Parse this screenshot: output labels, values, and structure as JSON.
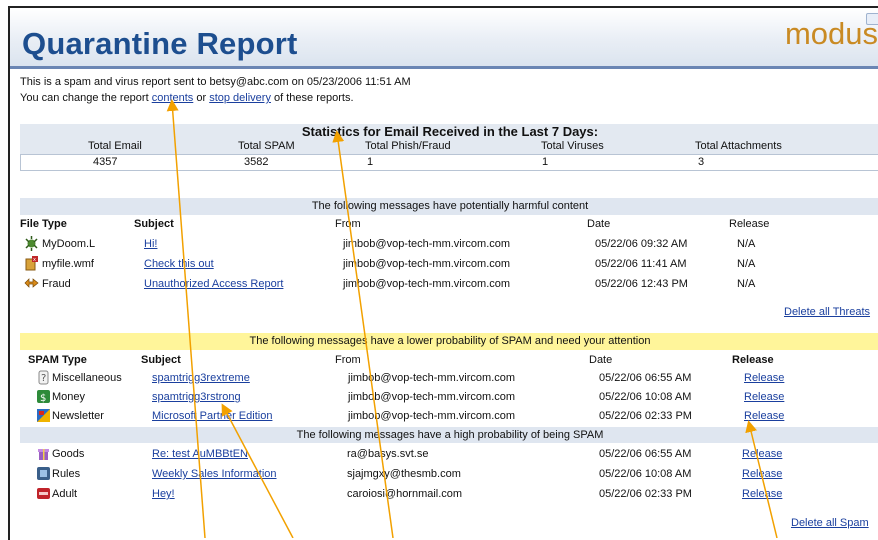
{
  "header": {
    "title": "Quarantine Report",
    "logo": "modus"
  },
  "intro": {
    "line1": "This is a spam and virus report sent to betsy@abc.com on 05/23/2006 11:51 AM",
    "line2_pre": "You can change the report ",
    "contents_link": "contents",
    "line2_mid": " or ",
    "stop_link": "stop delivery",
    "line2_post": " of these reports."
  },
  "stats": {
    "title": "Statistics for Email Received in the Last 7 Days:",
    "headers": [
      "Total Email",
      "Total SPAM",
      "Total Phish/Fraud",
      "Total Viruses",
      "Total Attachments"
    ],
    "values": [
      "4357",
      "3582",
      "1",
      "1",
      "3"
    ]
  },
  "threats": {
    "bar": "The following messages have potentially harmful content",
    "headers": [
      "File Type",
      "Subject",
      "From",
      "Date",
      "Release"
    ],
    "rows": [
      {
        "type": "MyDoom.L",
        "icon": "virus-icon",
        "subject": "Hi!",
        "from": "jimbob@vop-tech-mm.vircom.com",
        "date": "05/22/06 09:32 AM",
        "release": "N/A"
      },
      {
        "type": "myfile.wmf",
        "icon": "attachment-icon",
        "subject": "Check this out",
        "from": "jimbob@vop-tech-mm.vircom.com",
        "date": "05/22/06 11:41 AM",
        "release": "N/A"
      },
      {
        "type": "Fraud",
        "icon": "fraud-icon",
        "subject": "Unauthorized Access Report",
        "from": "jimbob@vop-tech-mm.vircom.com",
        "date": "05/22/06 12:43 PM",
        "release": "N/A"
      }
    ],
    "delete_all": "Delete all Threats"
  },
  "spam_low": {
    "bar": "The following messages have a lower probability of SPAM and need your attention",
    "headers": [
      "SPAM Type",
      "Subject",
      "From",
      "Date",
      "Release"
    ],
    "rows": [
      {
        "type": "Miscellaneous",
        "icon": "question-icon",
        "subject": "spamtrigg3rextreme",
        "from": "jimbob@vop-tech-mm.vircom.com",
        "date": "05/22/06  06:55 AM",
        "release": "Release"
      },
      {
        "type": "Money",
        "icon": "money-icon",
        "subject": "spamtrigg3rstrong",
        "from": "jimbob@vop-tech-mm.vircom.com",
        "date": "05/22/06  10:08 AM",
        "release": "Release"
      },
      {
        "type": "Newsletter",
        "icon": "newsletter-icon",
        "subject": "Microsoft Partner Edition",
        "from": "jimbob@vop-tech-mm.vircom.com",
        "date": "05/22/06  02:33 PM",
        "release": "Release"
      }
    ]
  },
  "spam_high": {
    "bar": "The following messages have a high probability of being SPAM",
    "rows": [
      {
        "type": "Goods",
        "icon": "goods-icon",
        "subject": "Re: test AuMBBtEN",
        "from": "ra@basys.svt.se",
        "date": "05/22/06  06:55 AM",
        "release": "Release"
      },
      {
        "type": "Rules",
        "icon": "rules-icon",
        "subject": "Weekly Sales Information",
        "from": "sjajmgxy@thesmb.com",
        "date": "05/22/06  10:08 AM",
        "release": "Release"
      },
      {
        "type": "Adult",
        "icon": "adult-icon",
        "subject": "Hey!",
        "from": "caroiosi@hornmail.com",
        "date": "05/22/06  02:33 PM",
        "release": "Release"
      }
    ],
    "delete_all": "Delete all Spam"
  },
  "colors": {
    "title": "#1d4e8f",
    "logo": "#c98a23",
    "link": "#1a3f9e",
    "highlight_bar": "#fff59a",
    "arrow": "#f2a100"
  }
}
